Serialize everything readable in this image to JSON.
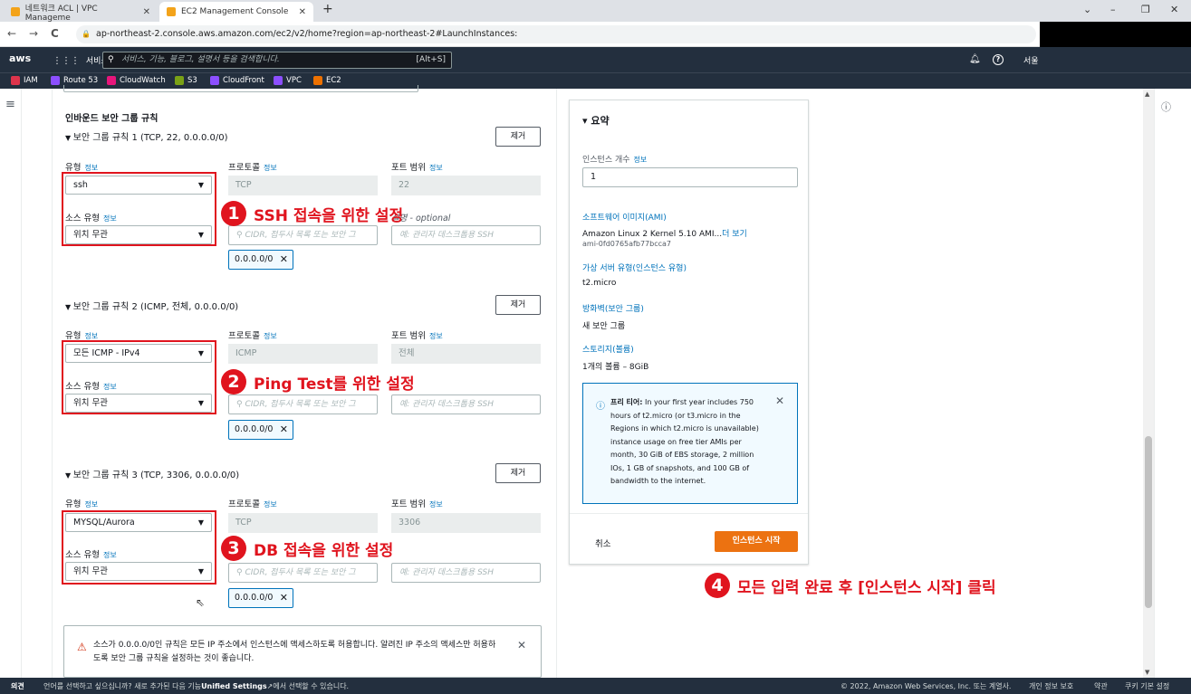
{
  "browser": {
    "tabs": [
      {
        "title": "네트워크 ACL | VPC Manageme",
        "close": "✕"
      },
      {
        "title": "EC2 Management Console",
        "close": "✕"
      }
    ],
    "new_tab": "+",
    "window_controls": [
      "⌄",
      "–",
      "❐",
      "✕"
    ],
    "nav": {
      "back": "←",
      "forward": "→",
      "reload": "C"
    },
    "url": "ap-northeast-2.console.aws.amazon.com/ec2/v2/home?region=ap-northeast-2#LaunchInstances:"
  },
  "aws_nav": {
    "logo": "aws",
    "services": "서비스",
    "search_placeholder": "서비스, 기능, 블로그, 설명서 등을 검색합니다.",
    "search_shortcut": "[Alt+S]",
    "region": "서울",
    "bell": "🔔",
    "help": "?"
  },
  "favorites": [
    {
      "label": "IAM",
      "color": "#dd344c"
    },
    {
      "label": "Route 53",
      "color": "#8c4fff"
    },
    {
      "label": "CloudWatch",
      "color": "#e7157b"
    },
    {
      "label": "S3",
      "color": "#7aa116"
    },
    {
      "label": "CloudFront",
      "color": "#8c4fff"
    },
    {
      "label": "VPC",
      "color": "#8c4fff"
    },
    {
      "label": "EC2",
      "color": "#ed7100"
    }
  ],
  "form": {
    "section_title": "인바운드 보안 그룹 규칙",
    "remove_label": "제거",
    "info_label": "정보",
    "type_label": "유형",
    "protocol_label": "프로토콜",
    "port_label": "포트 범위",
    "source_type_label": "소스 유형",
    "source_placeholder": "CIDR, 접두사 목록 또는 보안 그",
    "description_placeholder": "예: 관리자 데스크톱용 SSH",
    "description_label": "설명 - optional",
    "source_type_value": "위치 무관",
    "cidr_token": "0.0.0.0/0",
    "token_close": "✕",
    "rules": [
      {
        "title": "보안 그룹 규칙 1 (TCP, 22, 0.0.0.0/0)",
        "type": "ssh",
        "protocol": "TCP",
        "port": "22"
      },
      {
        "title": "보안 그룹 규칙 2 (ICMP, 전체, 0.0.0.0/0)",
        "type": "모든 ICMP - IPv4",
        "protocol": "ICMP",
        "port": "전체"
      },
      {
        "title": "보안 그룹 규칙 3 (TCP, 3306, 0.0.0.0/0)",
        "type": "MYSQL/Aurora",
        "protocol": "TCP",
        "port": "3306"
      }
    ],
    "warning": "소스가 0.0.0.0/0인 규칙은 모든 IP 주소에서 인스턴스에 액세스하도록 허용합니다. 알려진 IP 주소의 액세스만 허용하도록 보안 그룹 규칙을 설정하는 것이 좋습니다.",
    "warning_close": "✕"
  },
  "annotations": [
    {
      "num": "1",
      "text": "SSH 접속을 위한 설정"
    },
    {
      "num": "2",
      "text": "Ping Test를 위한 설정"
    },
    {
      "num": "3",
      "text": "DB 접속을 위한 설정"
    },
    {
      "num": "4",
      "text": "모든 입력 완료 후 [인스턴스 시작] 클릭"
    }
  ],
  "summary": {
    "title": "▾ 요약",
    "instance_count_label": "인스턴스 개수",
    "instance_count_info": "정보",
    "instance_count": "1",
    "ami_label": "소프트웨어 이미지(AMI)",
    "ami_value": "Amazon Linux 2 Kernel 5.10 AMI...",
    "ami_more": "더 보기",
    "ami_id": "ami-0fd0765afb77bcca7",
    "instance_type_label": "가상 서버 유형(인스턴스 유형)",
    "instance_type": "t2.micro",
    "firewall_label": "방화벽(보안 그룹)",
    "firewall_value": "새 보안 그룹",
    "storage_label": "스토리지(볼륨)",
    "storage_value": "1개의 볼륨 – 8GiB",
    "free_tier_bold": "프리 티어:",
    "free_tier_text": "In your first year includes 750 hours of t2.micro (or t3.micro in the Regions in which t2.micro is unavailable) instance usage on free tier AMIs per month, 30 GiB of EBS storage, 2 million IOs, 1 GB of snapshots, and 100 GB of bandwidth to the internet.",
    "free_tier_close": "✕",
    "cancel": "취소",
    "launch": "인스턴스 시작"
  },
  "footer": {
    "feedback": "의견",
    "language_text": "언어를 선택하고 싶으십니까? 새로 추가된 다음 기능",
    "language_link": "Unified Settings",
    "language_suffix": "에서 선택할 수 있습니다.",
    "copyright": "© 2022, Amazon Web Services, Inc. 또는 계열사.",
    "privacy": "개인 정보 보호",
    "terms": "약관",
    "cookies": "쿠키 기본 설정"
  }
}
